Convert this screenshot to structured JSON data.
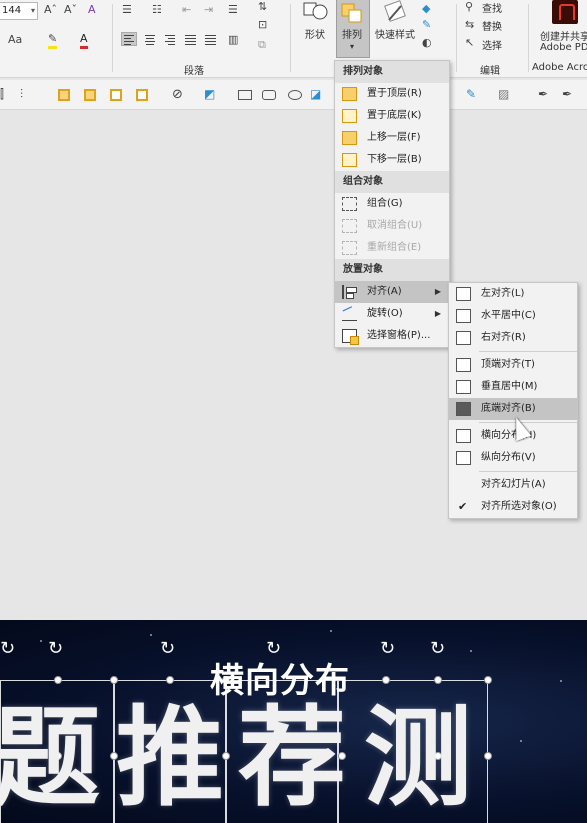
{
  "ribbon": {
    "font_size": "144",
    "font_grow": "Aˆ",
    "font_shrink": "Aˇ",
    "aa_label": "Aa",
    "paragraph_group": "段落",
    "shape_label": "形状",
    "arrange_label": "排列",
    "quick_style_label": "快速样式",
    "find_label": "查找",
    "replace_label": "替换",
    "select_label": "选择",
    "edit_group": "编辑",
    "pdf_label_1": "创建并共享",
    "pdf_label_2": "Adobe PD",
    "acrobat_group": "Adobe Acro"
  },
  "arrange_menu": {
    "section_order": "排列对象",
    "bring_front": "置于顶层(R)",
    "send_back": "置于底层(K)",
    "bring_forward": "上移一层(F)",
    "send_backward": "下移一层(B)",
    "section_group": "组合对象",
    "group": "组合(G)",
    "ungroup": "取消组合(U)",
    "regroup": "重新组合(E)",
    "section_position": "放置对象",
    "align": "对齐(A)",
    "rotate": "旋转(O)",
    "selection_pane": "选择窗格(P)..."
  },
  "align_submenu": {
    "align_left": "左对齐(L)",
    "align_center": "水平居中(C)",
    "align_right": "右对齐(R)",
    "align_top": "顶端对齐(T)",
    "align_middle": "垂直居中(M)",
    "align_bottom": "底端对齐(B)",
    "distribute_h": "横向分布(H)",
    "distribute_v": "纵向分布(V)",
    "align_slide": "对齐幻灯片(A)",
    "align_selected": "对齐所选对象(O)",
    "check": "✔"
  },
  "slide": {
    "caption": "横向分布",
    "chars": [
      "题",
      "推",
      "荐",
      "测"
    ]
  }
}
